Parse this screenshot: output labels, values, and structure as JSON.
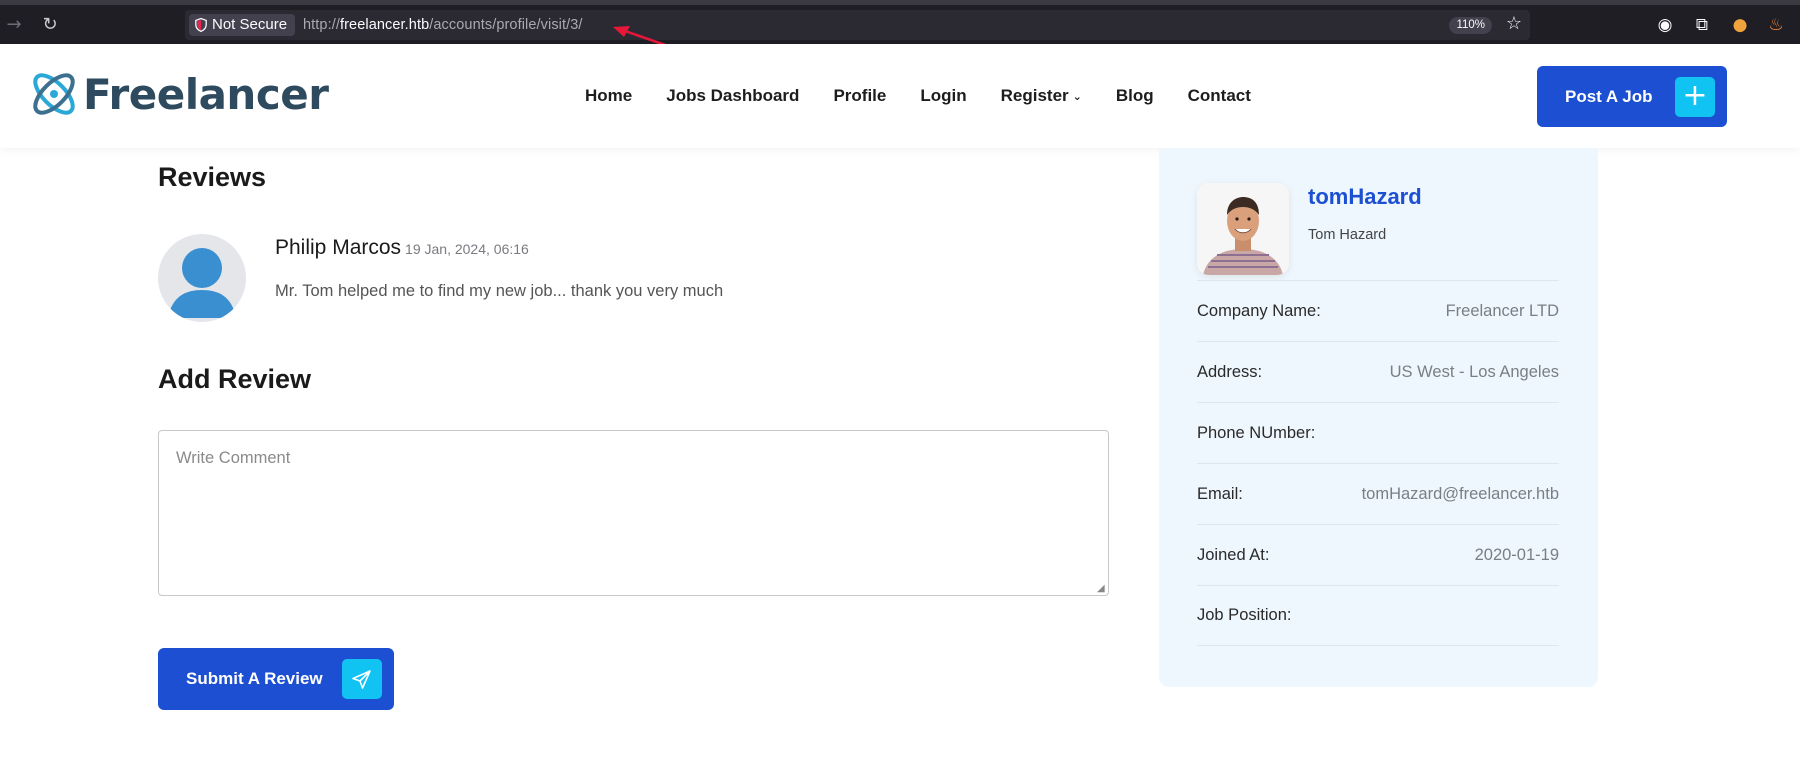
{
  "browser": {
    "security_label": "Not Secure",
    "url_scheme": "http://",
    "url_host": "freelancer.htb",
    "url_path": "/accounts/profile/visit/3/",
    "zoom": "110%"
  },
  "site": {
    "logo_text": "Freelancer",
    "nav": [
      {
        "label": "Home"
      },
      {
        "label": "Jobs Dashboard"
      },
      {
        "label": "Profile"
      },
      {
        "label": "Login"
      },
      {
        "label": "Register"
      },
      {
        "label": "Blog"
      },
      {
        "label": "Contact"
      }
    ],
    "post_job_label": "Post A Job"
  },
  "reviews": {
    "title": "Reviews",
    "items": [
      {
        "author": "Philip Marcos",
        "date": "19 Jan, 2024, 06:16",
        "comment": "Mr. Tom helped me to find my new job... thank you very much"
      }
    ]
  },
  "add_review": {
    "title": "Add Review",
    "placeholder": "Write Comment",
    "submit_label": "Submit A Review"
  },
  "profile": {
    "username": "tomHazard",
    "full_name": "Tom Hazard",
    "fields": [
      {
        "label": "Company Name:",
        "value": "Freelancer LTD"
      },
      {
        "label": "Address:",
        "value": "US West - Los Angeles"
      },
      {
        "label": "Phone NUmber:",
        "value": ""
      },
      {
        "label": "Email:",
        "value": "tomHazard@freelancer.htb"
      },
      {
        "label": "Joined At:",
        "value": "2020-01-19"
      },
      {
        "label": "Job Position:",
        "value": ""
      }
    ]
  },
  "colors": {
    "primary": "#1c4fd1",
    "accent": "#10c3f3",
    "annotation_arrow": "#e8173a"
  }
}
